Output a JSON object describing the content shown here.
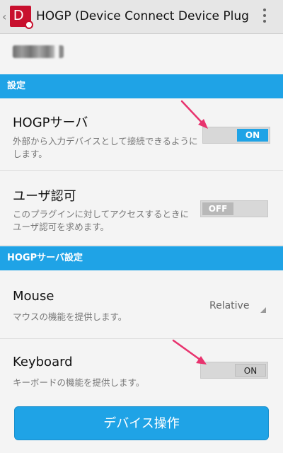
{
  "appbar": {
    "title": "HOGP (Device Connect Device Plug-",
    "icon_letter": "D"
  },
  "sections": {
    "settings_header": "設定",
    "server_header": "HOGPサーバ設定"
  },
  "hogp_server": {
    "title": "HOGPサーバ",
    "description": "外部から入力デバイスとして接続できるようにします。",
    "toggle": "ON"
  },
  "user_auth": {
    "title": "ユーザ認可",
    "description": "このプラグインに対してアクセスするときにユーザ認可を求めます。",
    "toggle": "OFF"
  },
  "mouse": {
    "title": "Mouse",
    "description": "マウスの機能を提供します。",
    "mode": "Relative"
  },
  "keyboard": {
    "title": "Keyboard",
    "description": "キーボードの機能を提供します。",
    "toggle": "ON"
  },
  "actions": {
    "device_operation": "デバイス操作"
  },
  "colors": {
    "accent": "#1fa3e6",
    "annotation_arrow": "#e8336e"
  }
}
